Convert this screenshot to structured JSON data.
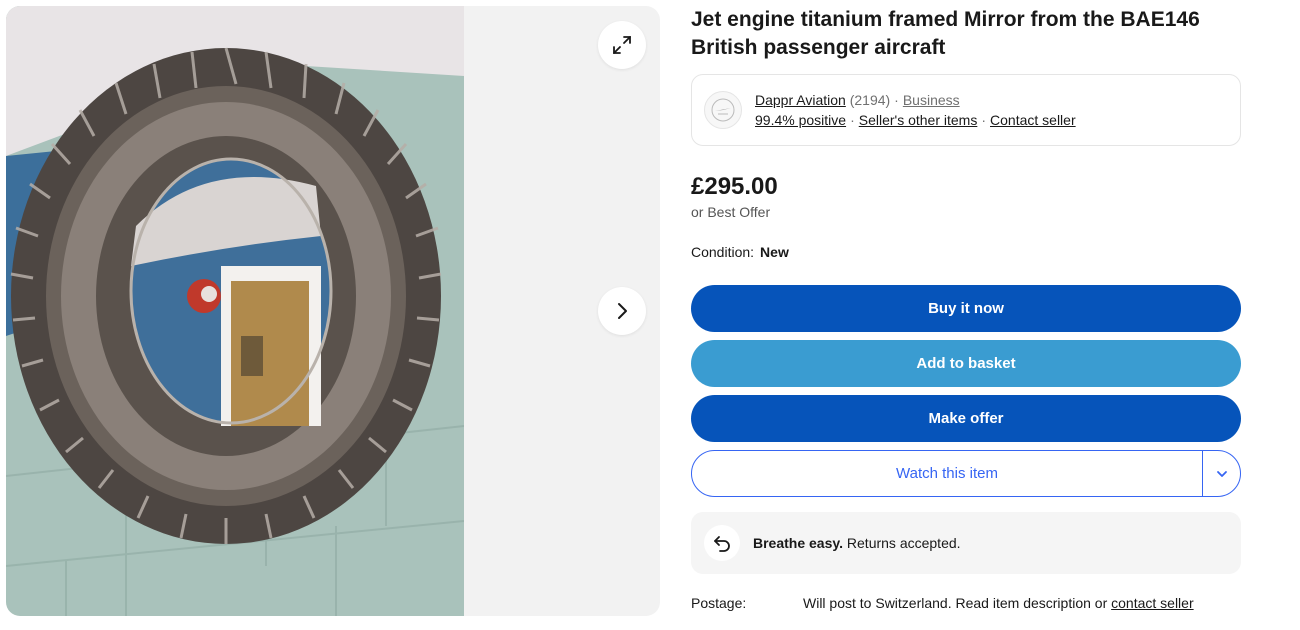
{
  "gallery": {
    "expand_icon": "expand-arrows-icon",
    "next_icon": "chevron-right-icon"
  },
  "listing": {
    "title": "Jet engine titanium framed Mirror from the BAE146 British passenger aircraft",
    "price": "£295.00",
    "best_offer": "or Best Offer",
    "condition_label": "Condition:",
    "condition_value": "New"
  },
  "seller": {
    "name": "Dappr Aviation",
    "feedback_count": "(2194)",
    "account_type": "Business",
    "positive": "99.4% positive",
    "other_items": "Seller's other items",
    "contact": "Contact seller"
  },
  "actions": {
    "buy_now": "Buy it now",
    "add_to_basket": "Add to basket",
    "make_offer": "Make offer",
    "watch": "Watch this item",
    "watch_dropdown_icon": "chevron-down-icon"
  },
  "returns": {
    "strong": "Breathe easy.",
    "text": "Returns accepted.",
    "icon": "return-arrow-icon"
  },
  "postage": {
    "label": "Postage:",
    "text": "Will post to Switzerland. Read item description or ",
    "link": "contact seller"
  },
  "colors": {
    "primary_blue": "#0654ba",
    "basket_blue": "#3a9cd1",
    "watch_blue": "#3665f3"
  }
}
